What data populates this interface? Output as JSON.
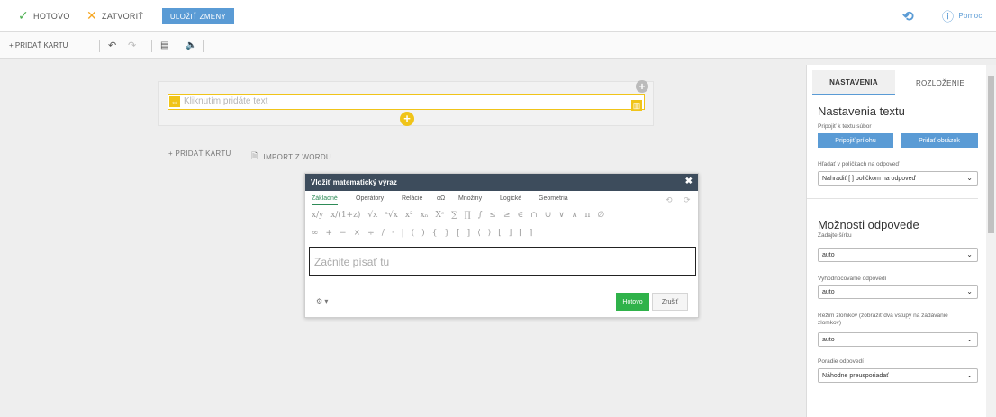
{
  "topbar": {
    "done_label": "HOTOVO",
    "close_label": "ZATVORIŤ",
    "save_label": "ULOŽIŤ ZMENY",
    "help_label": "Pomoc",
    "accent": "#5a9bd5"
  },
  "toolbar": {
    "add_card_label": "+ PRIDAŤ KARTU"
  },
  "card": {
    "placeholder": "Kliknutím pridáte text"
  },
  "links": {
    "add_card": "+ PRIDAŤ KARTU",
    "import_word": "IMPORT Z WORDU"
  },
  "math_dialog": {
    "title": "Vložiť matematický výraz",
    "tabs": [
      "Základné",
      "Operátory",
      "Relácie",
      "αΩ",
      "Množiny",
      "Logické",
      "Geometria"
    ],
    "active_tab": "Základné",
    "row1": [
      "x/y",
      "x/(1+z)",
      "√x",
      "ⁿ√x",
      "x²",
      "xₙ",
      "Xᶜ",
      "∑",
      "∏",
      "∫",
      "≤",
      "≥",
      "∈",
      "∩",
      "∪",
      "∨",
      "∧",
      "π",
      "∅"
    ],
    "row2": [
      "∞",
      "+",
      "−",
      "×",
      "÷",
      "/",
      "·",
      "|",
      "(",
      ")",
      "{",
      "}",
      "[",
      "]",
      "⟨",
      "⟩",
      "⌊",
      "⌋",
      "⌈",
      "⌉"
    ],
    "input_placeholder": "Začnite písať tu",
    "ok_label": "Hotovo",
    "cancel_label": "Zrušiť"
  },
  "panel": {
    "tabs": [
      "NASTAVENIA",
      "ROZLOŽENIE"
    ],
    "text_settings_title": "Nastavenia textu",
    "attach_label": "Pripojiť k textu súbor",
    "attach_button": "Pripojiť prílohu",
    "image_button": "Pridať obrázok",
    "search_label": "Hľadať v políčkach na odpoveď",
    "search_value": "Nahradiť [ ] políčkom na odpoveď",
    "answer_options_title": "Možnosti odpovede",
    "width_label": "Zadajte šírku",
    "width_value": "auto",
    "eval_label": "Vyhodnocovanie odpovedí",
    "eval_value": "auto",
    "fraction_label": "Režim zlomkov (zobraziť dva vstupy na zadávanie zlomkov)",
    "fraction_value": "auto",
    "order_label": "Poradie odpovedí",
    "order_value": "Náhodne preusporiadať"
  }
}
